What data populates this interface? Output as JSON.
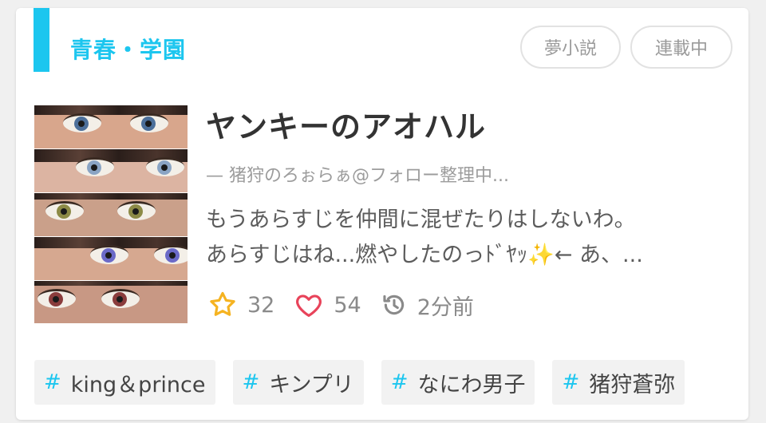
{
  "genre": "青春・学園",
  "badges": [
    "夢小説",
    "連載中"
  ],
  "title": "ヤンキーのアオハル",
  "author": "— 猪狩のろぉらぁ@フォロー整理中...",
  "summary_lines": [
    "もうあらすじを仲間に混ぜたりはしないわ。",
    "あらすじはね...燃やしたのっﾄﾞﾔｯ✨← あ、..."
  ],
  "stats": {
    "stars": "32",
    "likes": "54",
    "updated": "2分前"
  },
  "tags": [
    "king＆prince",
    "キンプリ",
    "なにわ男子",
    "猪狩蒼弥"
  ],
  "icons": {
    "star": "star-icon",
    "heart": "heart-icon",
    "clock": "history-clock-icon"
  },
  "colors": {
    "accent": "#1cc6ef",
    "star": "#f5b321",
    "heart": "#e8435a"
  }
}
